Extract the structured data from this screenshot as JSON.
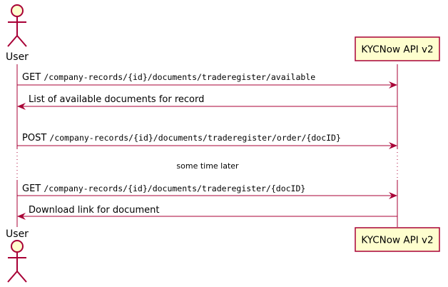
{
  "participants": {
    "user": {
      "name": "User",
      "kind": "actor"
    },
    "api": {
      "name": "KYCNow API v2",
      "kind": "participant"
    }
  },
  "messages": [
    {
      "from": "user",
      "to": "api",
      "method": "GET",
      "path": "/company-records/{id}/documents/traderegister/available"
    },
    {
      "from": "api",
      "to": "user",
      "text": "List of available documents for record"
    },
    {
      "from": "user",
      "to": "api",
      "method": "POST",
      "path": "/company-records/{id}/documents/traderegister/order/{docID}"
    },
    {
      "divider": "some time later"
    },
    {
      "from": "user",
      "to": "api",
      "method": "GET",
      "path": "/company-records/{id}/documents/traderegister/{docID}"
    },
    {
      "from": "api",
      "to": "user",
      "text": "Download link for document"
    }
  ],
  "colors": {
    "arrow": "#A80036",
    "participant_fill": "#FEFECE",
    "participant_border": "#A80036"
  }
}
